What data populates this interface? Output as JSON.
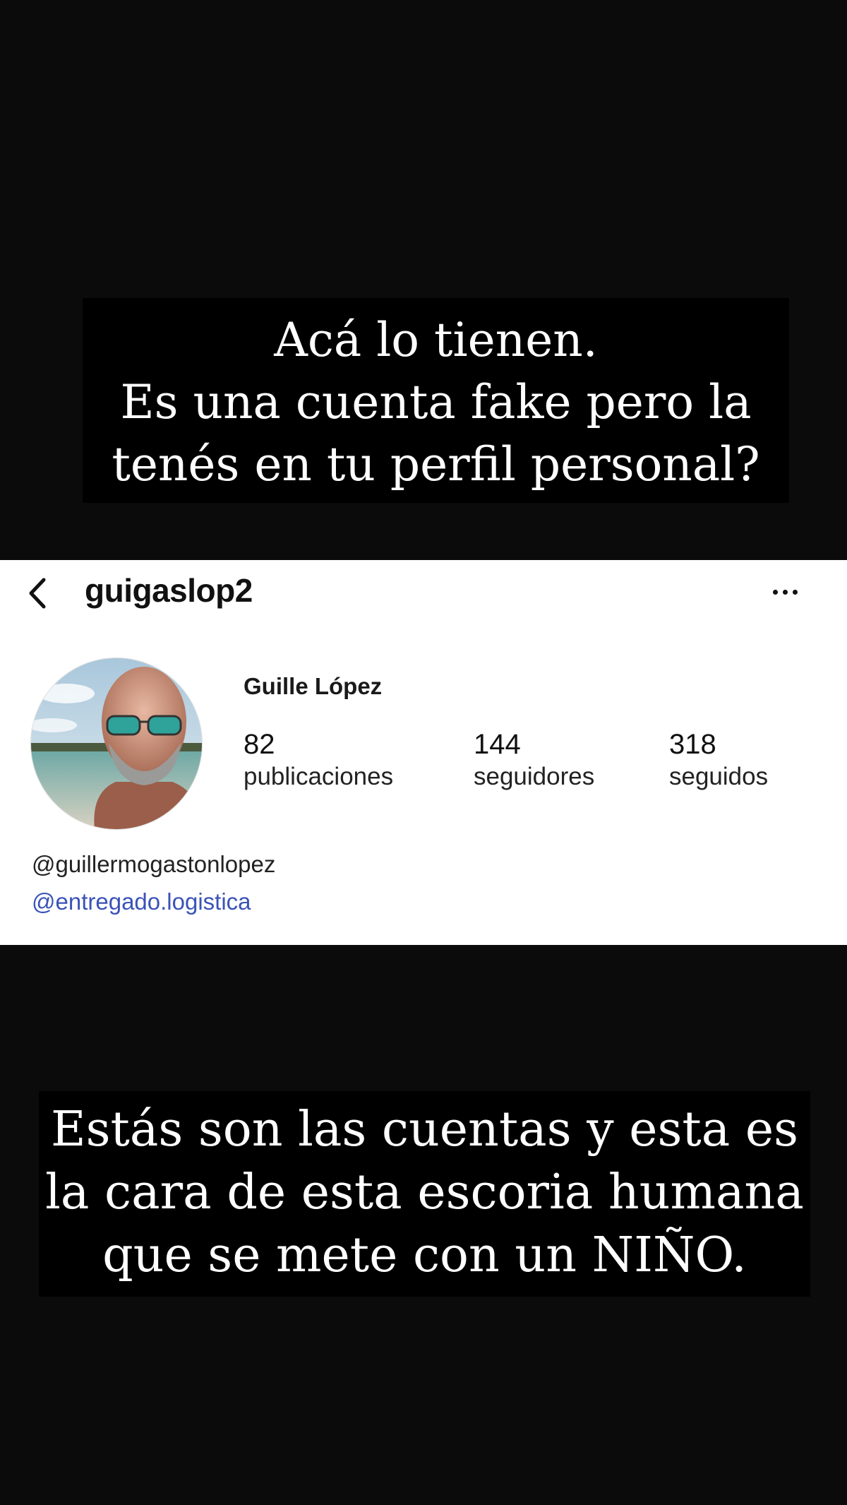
{
  "caption_top": {
    "lines": [
      "Acá lo tienen.",
      "Es una cuenta fake pero la",
      "tenés en tu perfil personal?"
    ]
  },
  "profile": {
    "header": {
      "back_icon": "chevron-left-icon",
      "username": "guigaslop2",
      "more_icon": "more-horizontal-icon"
    },
    "display_name": "Guille López",
    "stats": {
      "posts": {
        "value": "82",
        "label": "publicaciones"
      },
      "followers": {
        "value": "144",
        "label": "seguidores"
      },
      "following": {
        "value": "318",
        "label": "seguidos"
      }
    },
    "bio": {
      "handle": "@guillermogastonlopez",
      "link": "@entregado.logistica"
    },
    "colors": {
      "link": "#3b53b8",
      "card_bg": "#ffffff"
    }
  },
  "caption_bottom": {
    "lines": [
      "Estás son las cuentas y esta es",
      "la cara de esta escoria humana",
      "que se mete con un NIÑO."
    ]
  }
}
